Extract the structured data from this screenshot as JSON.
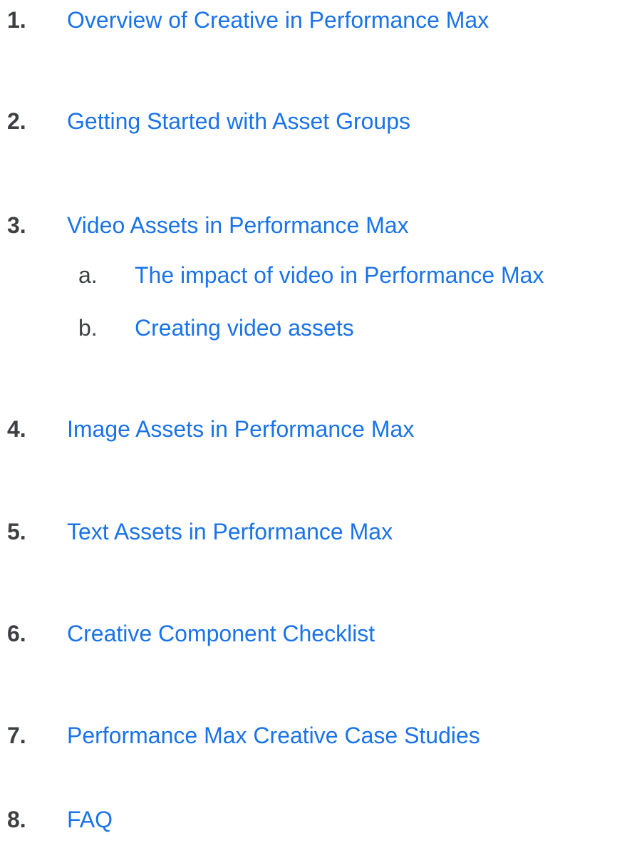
{
  "toc": {
    "items": [
      {
        "number": "1.",
        "title": "Overview of Creative in Performance Max"
      },
      {
        "number": "2.",
        "title": "Getting Started with Asset Groups"
      },
      {
        "number": "3.",
        "title": "Video Assets in Performance Max",
        "subitems": [
          {
            "letter": "a.",
            "title": "The impact of video in Performance Max"
          },
          {
            "letter": "b.",
            "title": "Creating video assets"
          }
        ]
      },
      {
        "number": "4.",
        "title": "Image Assets in Performance Max"
      },
      {
        "number": "5.",
        "title": "Text Assets in Performance Max"
      },
      {
        "number": "6.",
        "title": "Creative Component Checklist"
      },
      {
        "number": "7.",
        "title": "Performance Max Creative Case Studies"
      },
      {
        "number": "8.",
        "title": "FAQ"
      }
    ]
  },
  "colors": {
    "number": "#3c4043",
    "link": "#1a73e8"
  }
}
